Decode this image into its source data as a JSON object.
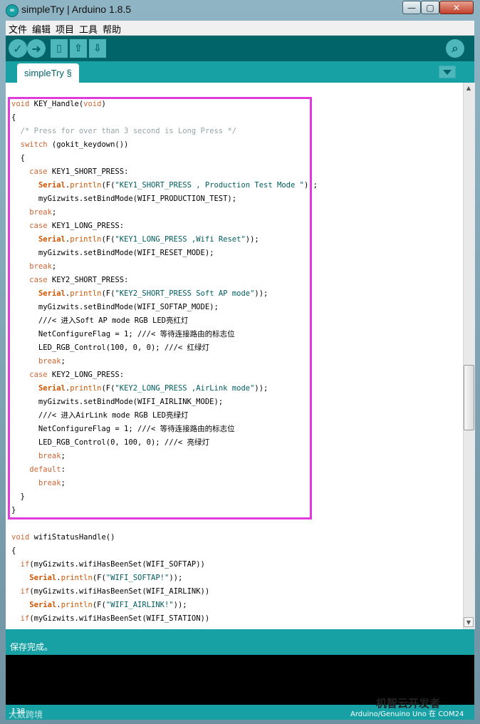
{
  "window": {
    "title": "simpleTry | Arduino 1.8.5",
    "app_icon_glyph": "∞",
    "minimize_glyph": "—",
    "maximize_glyph": "▢",
    "close_glyph": "✕"
  },
  "menu": [
    "文件",
    "编辑",
    "项目",
    "工具",
    "帮助"
  ],
  "toolbar": {
    "verify_glyph": "✓",
    "upload_glyph": "➜",
    "new_glyph": "▯",
    "open_glyph": "⇧",
    "save_glyph": "⇩",
    "serial_glyph": "⌕"
  },
  "tab": {
    "label": "simpleTry §",
    "menu_glyph": "▼"
  },
  "code_lines": [
    "void KEY_Handle(void)",
    "{",
    "  /* Press for over than 3 second is Long Press */",
    "  switch (gokit_keydown())",
    "  {",
    "    case KEY1_SHORT_PRESS:",
    "      Serial.println(F(\"KEY1_SHORT_PRESS , Production Test Mode \"));",
    "      myGizwits.setBindMode(WIFI_PRODUCTION_TEST);",
    "    break;",
    "    case KEY1_LONG_PRESS:",
    "      Serial.println(F(\"KEY1_LONG_PRESS ,Wifi Reset\"));",
    "      myGizwits.setBindMode(WIFI_RESET_MODE);",
    "    break;",
    "    case KEY2_SHORT_PRESS:",
    "      Serial.println(F(\"KEY2_SHORT_PRESS Soft AP mode\"));",
    "      myGizwits.setBindMode(WIFI_SOFTAP_MODE);",
    "      ///< 进入Soft AP mode RGB LED亮红灯",
    "      NetConfigureFlag = 1; ///< 等待连接路由的标志位",
    "      LED_RGB_Control(100, 0, 0); ///< 红绿灯",
    "      break;",
    "    case KEY2_LONG_PRESS:",
    "      Serial.println(F(\"KEY2_LONG_PRESS ,AirLink mode\"));",
    "      myGizwits.setBindMode(WIFI_AIRLINK_MODE);",
    "      ///< 进入AirLink mode RGB LED亮绿灯",
    "      NetConfigureFlag = 1; ///< 等待连接路由的标志位",
    "      LED_RGB_Control(0, 100, 0); ///< 亮绿灯",
    "      break;",
    "    default:",
    "      break;",
    "  }",
    "}",
    "",
    "void wifiStatusHandle()",
    "{",
    "  if(myGizwits.wifiHasBeenSet(WIFI_SOFTAP))",
    "    Serial.println(F(\"WIFI_SOFTAP!\"));",
    "  if(myGizwits.wifiHasBeenSet(WIFI_AIRLINK))",
    "    Serial.println(F(\"WIFI_AIRLINK!\"));",
    "  if(myGizwits.wifiHasBeenSet(WIFI_STATION))"
  ],
  "status_message": "保存完成。",
  "line_number": "138",
  "board_info": "Arduino/Genuino Uno 在 COM24",
  "watermark_left": "大数跨境",
  "watermark_right": "机智云开发者",
  "colors": {
    "teal_dark": "#006468",
    "teal": "#17a1a5",
    "highlight_box": "#e03cdd"
  }
}
